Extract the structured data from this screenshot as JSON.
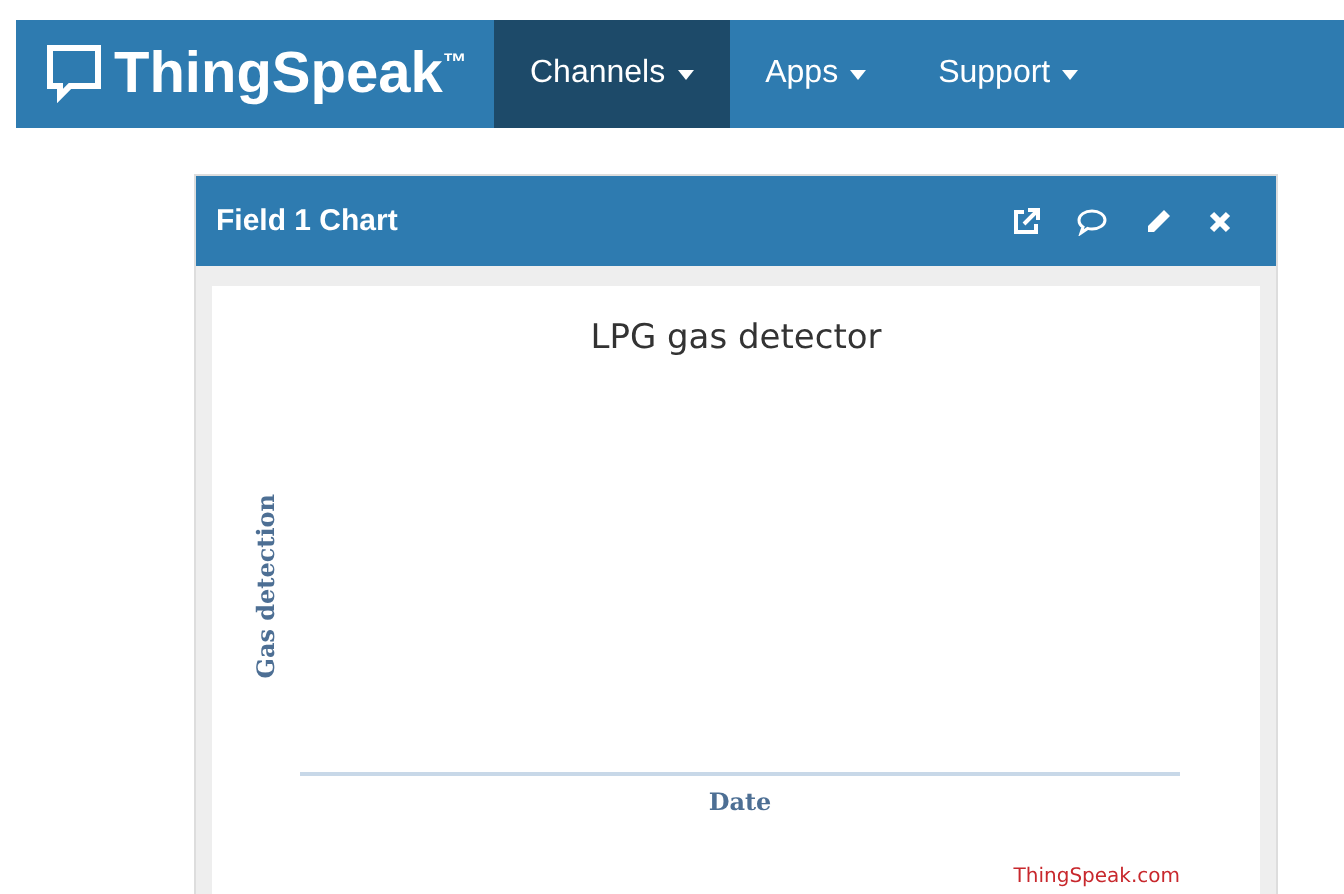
{
  "navbar": {
    "brand": "ThingSpeak",
    "trademark": "™",
    "items": [
      {
        "label": "Channels",
        "selected": true
      },
      {
        "label": "Apps",
        "selected": false
      },
      {
        "label": "Support",
        "selected": false
      }
    ]
  },
  "panel": {
    "title": "Field 1 Chart",
    "chart": {
      "title": "LPG gas detector",
      "xlabel": "Date",
      "ylabel": "Gas detection",
      "credit": "ThingSpeak.com"
    }
  }
}
